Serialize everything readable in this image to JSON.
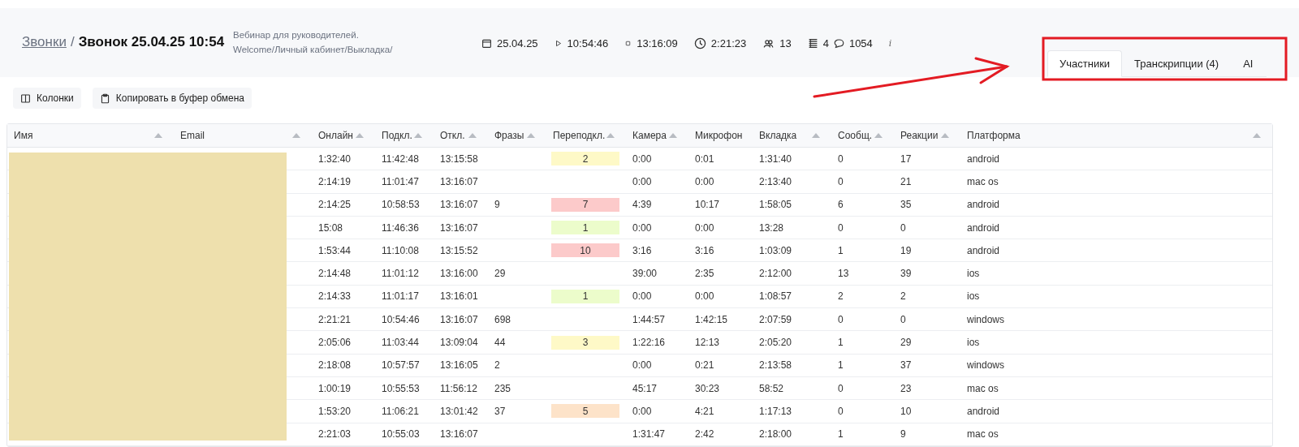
{
  "breadcrumb": {
    "link": "Звонки",
    "separator": "/",
    "title": "Звонок 25.04.25 10:54"
  },
  "description": [
    "Вебинар для руководителей.",
    "Welcome/Личный кабинет/Выкладка/"
  ],
  "meta": [
    {
      "kind": "date",
      "text": "25.04.25"
    },
    {
      "kind": "start",
      "text": "10:54:46"
    },
    {
      "kind": "end",
      "text": "13:16:09"
    },
    {
      "kind": "duration",
      "text": "2:21:23"
    },
    {
      "kind": "participants",
      "text": "13"
    },
    {
      "kind": "transcripts",
      "text": "4"
    },
    {
      "kind": "messages",
      "text": "1054"
    },
    {
      "kind": "info",
      "text": "i"
    }
  ],
  "tabs": [
    {
      "label": "Участники",
      "selected": true
    },
    {
      "label": "Транскрипции (4)",
      "selected": false
    },
    {
      "label": "AI",
      "selected": false
    }
  ],
  "toolbar": [
    {
      "kind": "columns",
      "label": "Колонки"
    },
    {
      "kind": "copy",
      "label": "Копировать в буфер обмена"
    }
  ],
  "table": {
    "columns": [
      "Имя",
      "Email",
      "Онлайн",
      "Подкл.",
      "Откл.",
      "Фразы",
      "Переподкл.",
      "Камера",
      "Микрофон",
      "Вкладка",
      "Сообщ.",
      "Реакции",
      "Платформа"
    ],
    "rows": [
      {
        "online": "1:32:40",
        "connected": "11:42:48",
        "disconnected": "13:15:58",
        "phrases": "",
        "reconnects": {
          "text": "2",
          "color": "#fef9c7"
        },
        "camera": "0:00",
        "microphone": "0:01",
        "tab": "1:31:40",
        "messages": "0",
        "reactions": "17",
        "platform": "android"
      },
      {
        "online": "2:14:19",
        "connected": "11:01:47",
        "disconnected": "13:16:07",
        "phrases": "",
        "reconnects": null,
        "camera": "0:00",
        "microphone": "0:00",
        "tab": "2:13:40",
        "messages": "0",
        "reactions": "21",
        "platform": "mac os"
      },
      {
        "online": "2:14:25",
        "connected": "10:58:53",
        "disconnected": "13:16:07",
        "phrases": "9",
        "reconnects": {
          "text": "7",
          "color": "#fccaca"
        },
        "camera": "4:39",
        "microphone": "10:17",
        "tab": "1:58:05",
        "messages": "6",
        "reactions": "35",
        "platform": "android"
      },
      {
        "online": "15:08",
        "connected": "11:46:36",
        "disconnected": "13:16:07",
        "phrases": "",
        "reconnects": {
          "text": "1",
          "color": "#ecfccb"
        },
        "camera": "0:00",
        "microphone": "0:00",
        "tab": "13:28",
        "messages": "0",
        "reactions": "0",
        "platform": "android"
      },
      {
        "online": "1:53:44",
        "connected": "11:10:08",
        "disconnected": "13:15:52",
        "phrases": "",
        "reconnects": {
          "text": "10",
          "color": "#fccaca"
        },
        "camera": "3:16",
        "microphone": "3:16",
        "tab": "1:03:09",
        "messages": "1",
        "reactions": "19",
        "platform": "android"
      },
      {
        "online": "2:14:48",
        "connected": "11:01:12",
        "disconnected": "13:16:00",
        "phrases": "29",
        "reconnects": null,
        "camera": "39:00",
        "microphone": "2:35",
        "tab": "2:12:00",
        "messages": "13",
        "reactions": "39",
        "platform": "ios"
      },
      {
        "online": "2:14:33",
        "connected": "11:01:17",
        "disconnected": "13:16:01",
        "phrases": "",
        "reconnects": {
          "text": "1",
          "color": "#ecfccb"
        },
        "camera": "0:00",
        "microphone": "0:00",
        "tab": "1:08:57",
        "messages": "2",
        "reactions": "2",
        "platform": "ios"
      },
      {
        "online": "2:21:21",
        "connected": "10:54:46",
        "disconnected": "13:16:07",
        "phrases": "698",
        "reconnects": null,
        "camera": "1:44:57",
        "microphone": "1:42:15",
        "tab": "2:07:59",
        "messages": "0",
        "reactions": "0",
        "platform": "windows"
      },
      {
        "online": "2:05:06",
        "connected": "11:03:44",
        "disconnected": "13:09:04",
        "phrases": "44",
        "reconnects": {
          "text": "3",
          "color": "#fef9c7"
        },
        "camera": "1:22:16",
        "microphone": "12:13",
        "tab": "2:05:20",
        "messages": "1",
        "reactions": "29",
        "platform": "ios"
      },
      {
        "online": "2:18:08",
        "connected": "10:57:57",
        "disconnected": "13:16:05",
        "phrases": "2",
        "reconnects": null,
        "camera": "0:00",
        "microphone": "0:21",
        "tab": "2:13:58",
        "messages": "1",
        "reactions": "37",
        "platform": "windows"
      },
      {
        "online": "1:00:19",
        "connected": "10:55:53",
        "disconnected": "11:56:12",
        "phrases": "235",
        "reconnects": null,
        "camera": "45:17",
        "microphone": "30:23",
        "tab": "58:52",
        "messages": "0",
        "reactions": "23",
        "platform": "mac os"
      },
      {
        "online": "1:53:20",
        "connected": "11:06:21",
        "disconnected": "13:01:42",
        "phrases": "37",
        "reconnects": {
          "text": "5",
          "color": "#fde3c9"
        },
        "camera": "0:00",
        "microphone": "4:21",
        "tab": "1:17:13",
        "messages": "0",
        "reactions": "10",
        "platform": "android"
      },
      {
        "online": "2:21:03",
        "connected": "10:55:03",
        "disconnected": "13:16:07",
        "phrases": "",
        "reconnects": null,
        "camera": "1:31:47",
        "microphone": "2:42",
        "tab": "2:18:00",
        "messages": "1",
        "reactions": "9",
        "platform": "mac os"
      }
    ]
  }
}
